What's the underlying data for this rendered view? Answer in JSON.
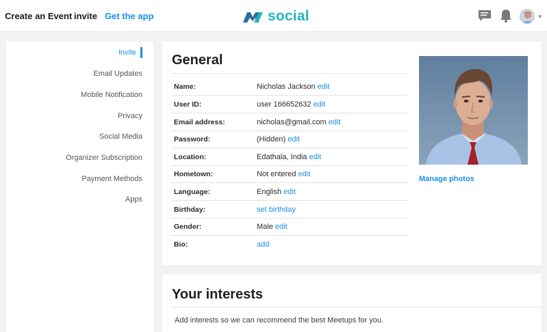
{
  "header": {
    "create_event": "Create an Event",
    "invite": "invite",
    "get_app": "Get the app",
    "logo_text": "social"
  },
  "sidebar": {
    "items": [
      {
        "label": "invite",
        "active": true
      },
      {
        "label": "Email Updates"
      },
      {
        "label": "Mobile Notification"
      },
      {
        "label": "Privacy"
      },
      {
        "label": "Social Media"
      },
      {
        "label": "Organizer Subscription"
      },
      {
        "label": "Payment Methods"
      },
      {
        "label": "Apps"
      }
    ]
  },
  "general": {
    "title": "General",
    "rows": [
      {
        "label": "Name:",
        "value": "Nicholas Jackson",
        "action": "edit"
      },
      {
        "label": "User ID:",
        "value": "user 166652632",
        "action": "edit"
      },
      {
        "label": "Email address:",
        "value": "nicholas@gmail.com",
        "action": "edit"
      },
      {
        "label": "Password:",
        "value": "(Hidden)",
        "action": "edit"
      },
      {
        "label": "Location:",
        "value": "Edathala, India",
        "action": "edit"
      },
      {
        "label": "Hometown:",
        "value": "Not entered",
        "action": "edit"
      },
      {
        "label": "Language:",
        "value": "English",
        "action": "edit"
      },
      {
        "label": "Birthday:",
        "value": "",
        "action": "set birthday"
      },
      {
        "label": "Gender:",
        "value": "Male",
        "action": "edit"
      },
      {
        "label": "Bio:",
        "value": "",
        "action": "add"
      }
    ],
    "manage_photos": "Manage photos"
  },
  "interests": {
    "title": "Your interests",
    "description": "Add interests so we can recommend the best Meetups for you."
  },
  "colors": {
    "accent": "#1a8ee6",
    "brand": "#23b4bf",
    "background": "#f2f2f2"
  }
}
